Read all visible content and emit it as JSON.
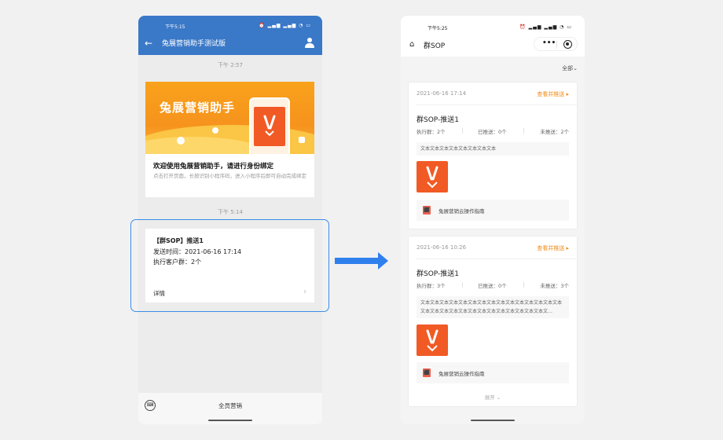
{
  "left_phone": {
    "status_time": "下午5:15",
    "status_icons": "⏰ ▂▄▆ ▂▄▆ ◔ ▭",
    "back_icon": "arrow-left-icon",
    "title": "兔展营销助手测试版",
    "timestamp1": "下午 2:57",
    "banner_title": "兔展营销助手",
    "welcome_title": "欢迎使用兔展营销助手，请进行身份绑定",
    "welcome_desc": "点击打开页面，长按识别小程序码，进入小程序后即可自动完成绑定",
    "timestamp2": "下午 5:14",
    "push_title": "【群SOP】推送1",
    "push_time": "发送时间：2021-06-16 17:14",
    "push_groups": "执行客户群：2个",
    "detail_label": "详情",
    "bottom_label": "全员营销",
    "accent": "#3a78c8"
  },
  "right_phone": {
    "status_time": "下午5:25",
    "status_icons": "⏰ ▂▄▆ ▂▄▆ ◔ ▭",
    "title": "群SOP",
    "more_glyph": "•••",
    "filter_label": "全部⌄",
    "items": [
      {
        "date": "2021-06-16 17:14",
        "view_label": "查看并推送 ▸",
        "title": "群SOP-推送1",
        "exec": "执行群：2个",
        "pushed": "已推送：0个",
        "unpushed": "未推送：2个",
        "text": "文本文本文本文本文本文本文本文本",
        "file_name": "兔展营销云操作指南"
      },
      {
        "date": "2021-06-16 10:26",
        "view_label": "查看并推送 ▸",
        "title": "群SOP-推送1",
        "exec": "执行群：3个",
        "pushed": "已推送：0个",
        "unpushed": "未推送：3个",
        "text": "文本文本文本文本文本文本文本文本文本文本文本文本文本文本文本文本文本文本文本文本文本文本文本文本文本文本文本文本文…",
        "file_name": "兔展营销云操作指南",
        "expand_label": "展开 ⌄"
      }
    ],
    "accent_orange": "#f08a16"
  }
}
